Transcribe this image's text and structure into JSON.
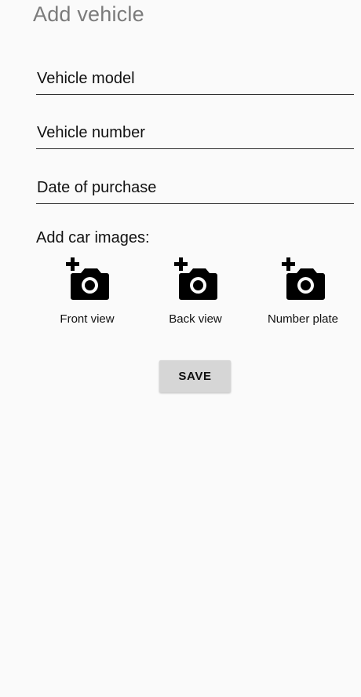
{
  "header": {
    "title": "Add vehicle"
  },
  "form": {
    "vehicle_model": {
      "placeholder": "Vehicle model",
      "value": ""
    },
    "vehicle_number": {
      "placeholder": "Vehicle number",
      "value": ""
    },
    "date_of_purchase": {
      "placeholder": "Date of purchase",
      "value": ""
    }
  },
  "images": {
    "label": "Add car images:",
    "items": [
      {
        "icon": "add-a-photo-icon",
        "caption": "Front view"
      },
      {
        "icon": "add-a-photo-icon",
        "caption": "Back view"
      },
      {
        "icon": "add-a-photo-icon",
        "caption": "Number plate"
      }
    ]
  },
  "actions": {
    "save_label": "SAVE"
  },
  "colors": {
    "background": "#fafafa",
    "title": "#7b7b7b",
    "button": "#d6d6d6",
    "text": "#111111"
  }
}
